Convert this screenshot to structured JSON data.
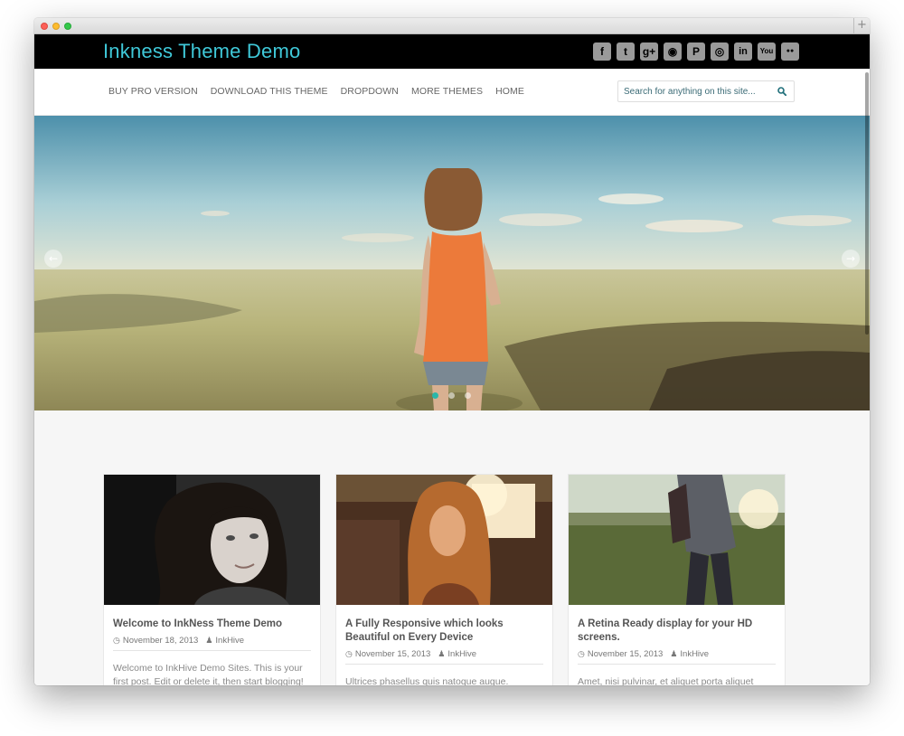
{
  "site": {
    "title": "Inkness Theme Demo"
  },
  "social": [
    {
      "icon": "facebook-icon",
      "glyph": "f"
    },
    {
      "icon": "twitter-icon",
      "glyph": "t"
    },
    {
      "icon": "google-plus-icon",
      "glyph": "g+"
    },
    {
      "icon": "rss-icon",
      "glyph": "◉"
    },
    {
      "icon": "pinterest-icon",
      "glyph": "P"
    },
    {
      "icon": "instagram-icon",
      "glyph": "◎"
    },
    {
      "icon": "linkedin-icon",
      "glyph": "in"
    },
    {
      "icon": "youtube-icon",
      "glyph": "You"
    },
    {
      "icon": "flickr-icon",
      "glyph": "●●"
    }
  ],
  "nav": {
    "items": [
      "BUY PRO VERSION",
      "DOWNLOAD THIS THEME",
      "DROPDOWN",
      "MORE THEMES",
      "HOME"
    ]
  },
  "search": {
    "placeholder": "Search for anything on this site..."
  },
  "slider": {
    "prev_glyph": "←",
    "next_glyph": "→",
    "active_dot": 0,
    "dot_count": 3
  },
  "posts": [
    {
      "title": "Welcome to InkNess Theme Demo",
      "date": "November 18, 2013",
      "author": "InkHive",
      "excerpt": "Welcome to InkHive Demo Sites. This is your first post. Edit or delete it, then start blogging!"
    },
    {
      "title": "A Fully Responsive which looks Beautiful on Every Device",
      "date": "November 15, 2013",
      "author": "InkHive",
      "excerpt": "Ultrices phasellus quis natoque augue."
    },
    {
      "title": "A Retina Ready display for your HD screens.",
      "date": "November 15, 2013",
      "author": "InkHive",
      "excerpt": "Amet, nisi pulvinar, et aliquet porta aliquet odio."
    }
  ],
  "colors": {
    "accent": "#3fc8d8",
    "topbar": "#000000",
    "slider_dot_active": "#2ab7a9"
  }
}
